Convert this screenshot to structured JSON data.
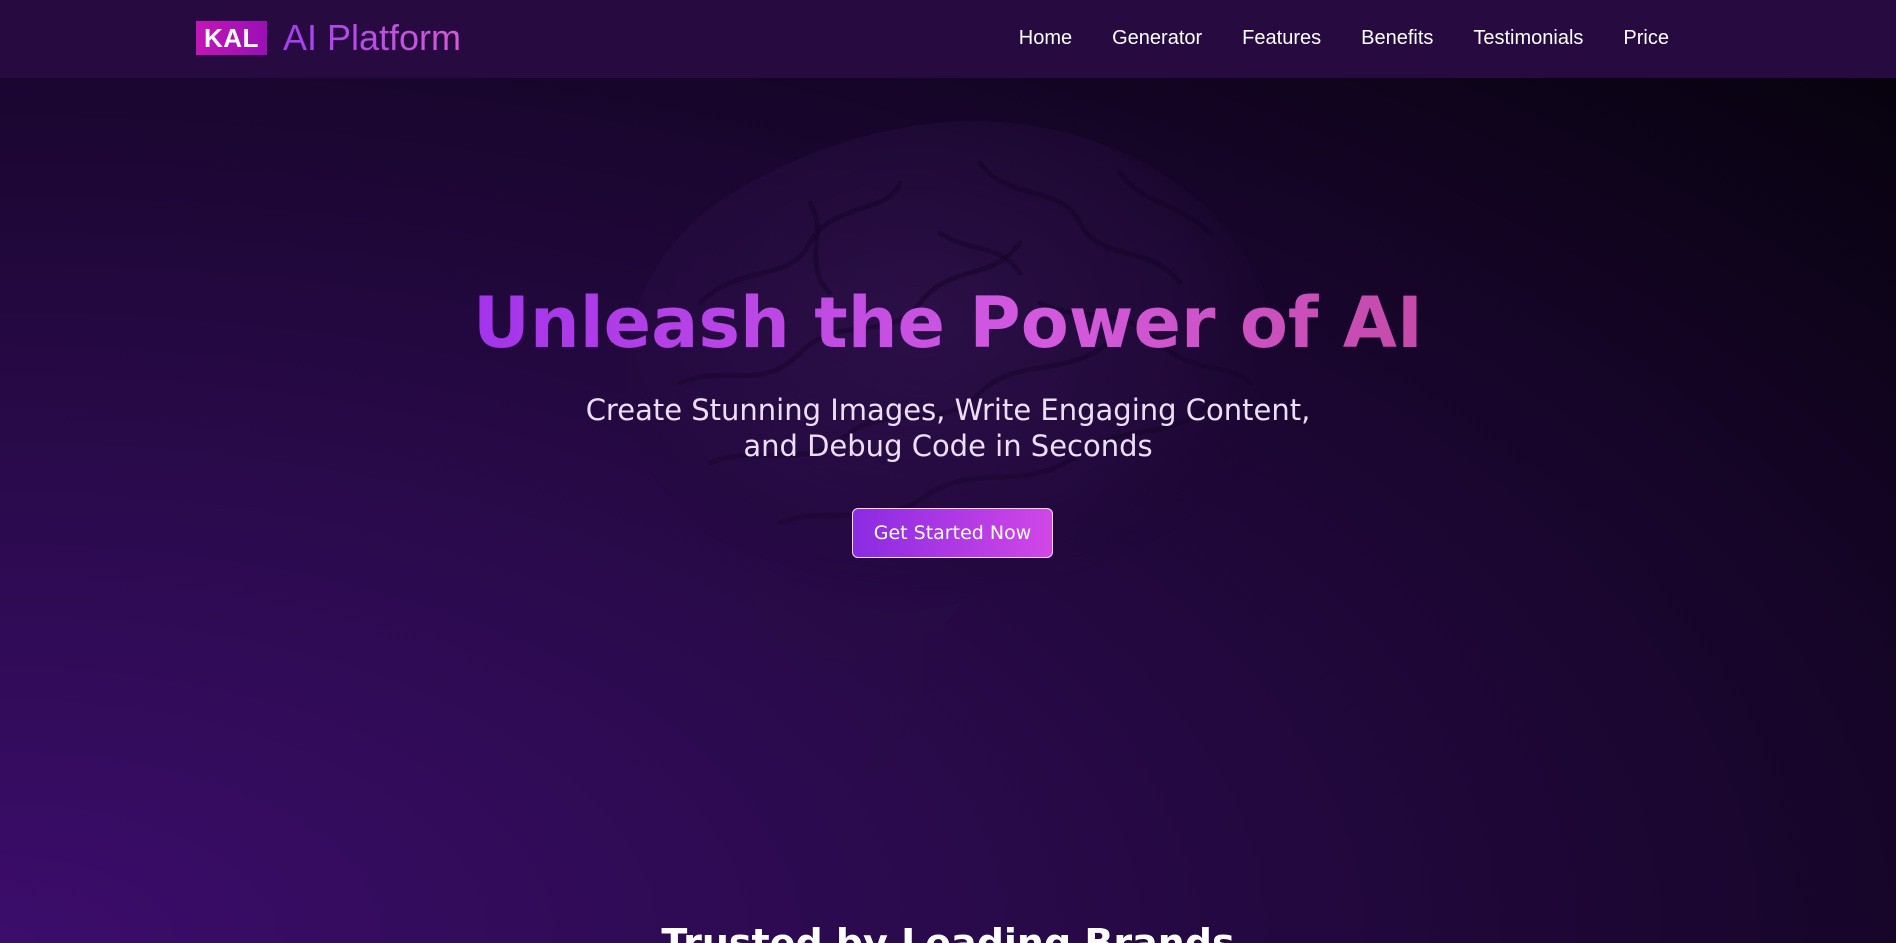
{
  "navbar": {
    "brand_badge": "KAL",
    "brand_name": "AI Platform",
    "links": [
      "Home",
      "Generator",
      "Features",
      "Benefits",
      "Testimonials",
      "Price"
    ]
  },
  "hero": {
    "title": "Unleash the Power of AI",
    "subtitle_line1": "Create Stunning Images, Write Engaging Content,",
    "subtitle_line2": "and Debug Code in Seconds",
    "cta_label": "Get Started Now",
    "background_image": "brain-icon"
  },
  "trusted": {
    "heading": "Trusted by Leading Brands"
  },
  "colors": {
    "navbar_bg": "#260a40",
    "accent_start": "#8a2be2",
    "accent_end": "#d147e6",
    "badge": "#c216b7"
  }
}
